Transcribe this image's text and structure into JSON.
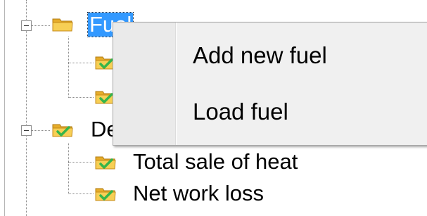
{
  "tree": {
    "nodes": [
      {
        "label": "Fuel",
        "selected": true,
        "icon": "folder-icon"
      },
      {
        "label": "",
        "icon": "folder-checked-icon"
      },
      {
        "label": "",
        "icon": "folder-checked-icon"
      },
      {
        "label": "Dе",
        "icon": "folder-checked-icon"
      },
      {
        "label": "Total sale of heat",
        "icon": "folder-checked-icon"
      },
      {
        "label": "Net work loss",
        "icon": "folder-checked-icon"
      }
    ]
  },
  "context_menu": {
    "items": [
      {
        "label": "Add new fuel"
      },
      {
        "label": "Load fuel"
      }
    ]
  },
  "colors": {
    "selection": "#3399ff",
    "folder": "#f2c33c",
    "checkmark": "#36b54a",
    "menu_background": "#f0f0f0"
  }
}
